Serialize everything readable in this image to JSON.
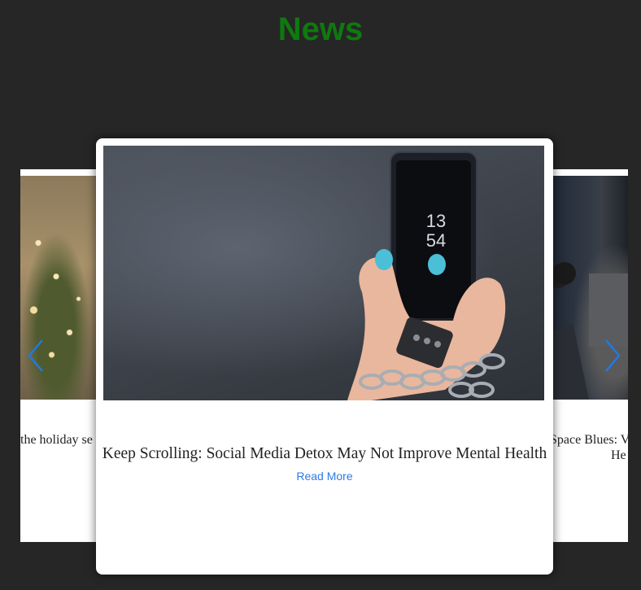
{
  "page": {
    "heading": "News"
  },
  "carousel": {
    "prev_icon": "chevron-left-icon",
    "next_icon": "chevron-right-icon",
    "arrow_color": "#1e7be3",
    "left_card": {
      "title_fragment": "the holiday se"
    },
    "center_card": {
      "title": "Keep Scrolling: Social Media Detox May Not Improve Mental Health",
      "link_label": "Read More",
      "phone_time_hour": "13",
      "phone_time_minute": "54"
    },
    "right_card": {
      "title_line1": "Space Blues: V",
      "title_line2": "He"
    }
  },
  "colors": {
    "background": "#262626",
    "heading": "#0e7a0e",
    "link": "#2c7be5"
  }
}
